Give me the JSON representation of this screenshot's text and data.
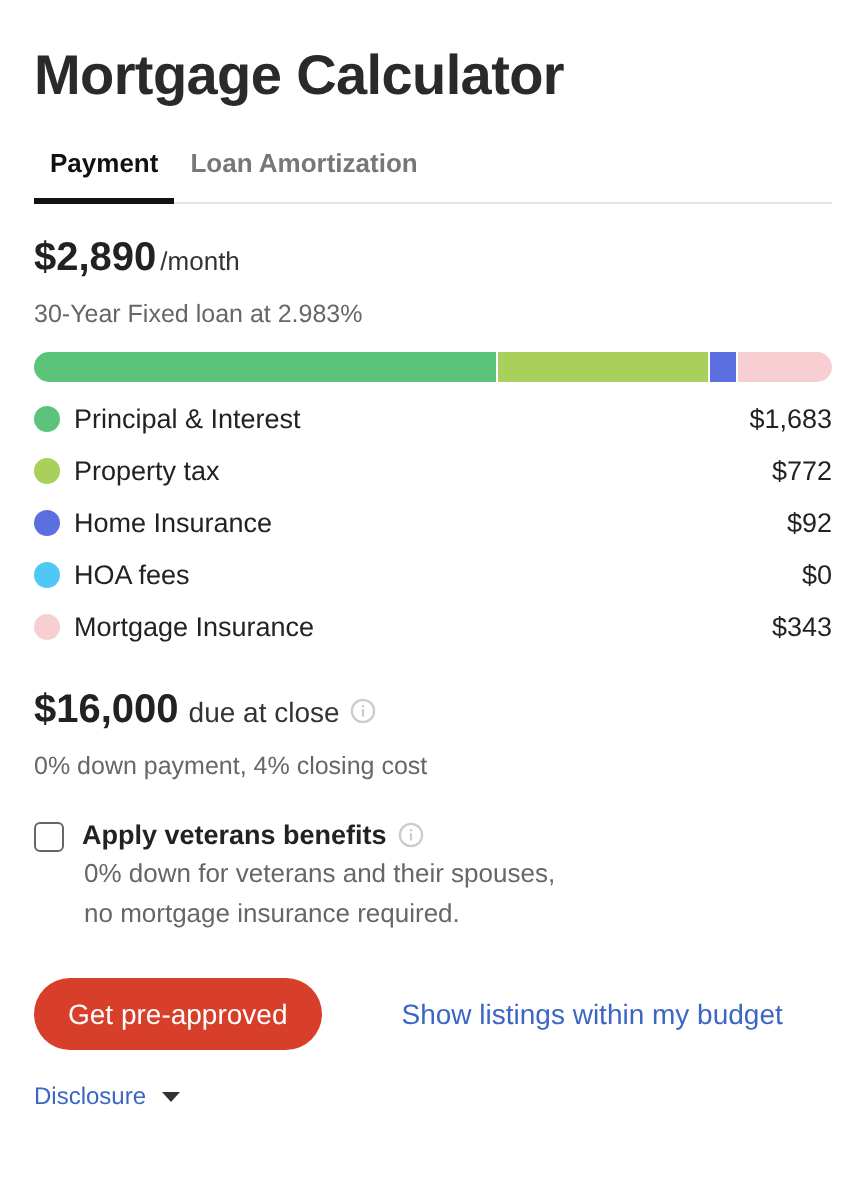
{
  "title": "Mortgage Calculator",
  "tabs": [
    {
      "label": "Payment",
      "selected": true
    },
    {
      "label": "Loan Amortization",
      "selected": false
    }
  ],
  "monthly": {
    "amount": "$2,890",
    "unit": "/month",
    "subtitle": "30-Year Fixed loan at 2.983%"
  },
  "breakdown": [
    {
      "name": "Principal & Interest",
      "amount": "$1,683",
      "color": "#5cc47a"
    },
    {
      "name": "Property tax",
      "amount": "$772",
      "color": "#a8d05a"
    },
    {
      "name": "Home Insurance",
      "amount": "$92",
      "color": "#5b6fe0"
    },
    {
      "name": "HOA fees",
      "amount": "$0",
      "color": "#50c8f5"
    },
    {
      "name": "Mortgage Insurance",
      "amount": "$343",
      "color": "#f7cfd3"
    }
  ],
  "closing": {
    "amount": "$16,000",
    "label": "due at close",
    "subtitle": "0% down payment, 4% closing cost"
  },
  "veterans": {
    "label": "Apply veterans benefits",
    "checked": false,
    "description": "0% down for veterans and their spouses,\nno mortgage insurance required."
  },
  "primary_button": "Get pre-approved",
  "link": "Show listings within my budget",
  "disclosure": "Disclosure"
}
